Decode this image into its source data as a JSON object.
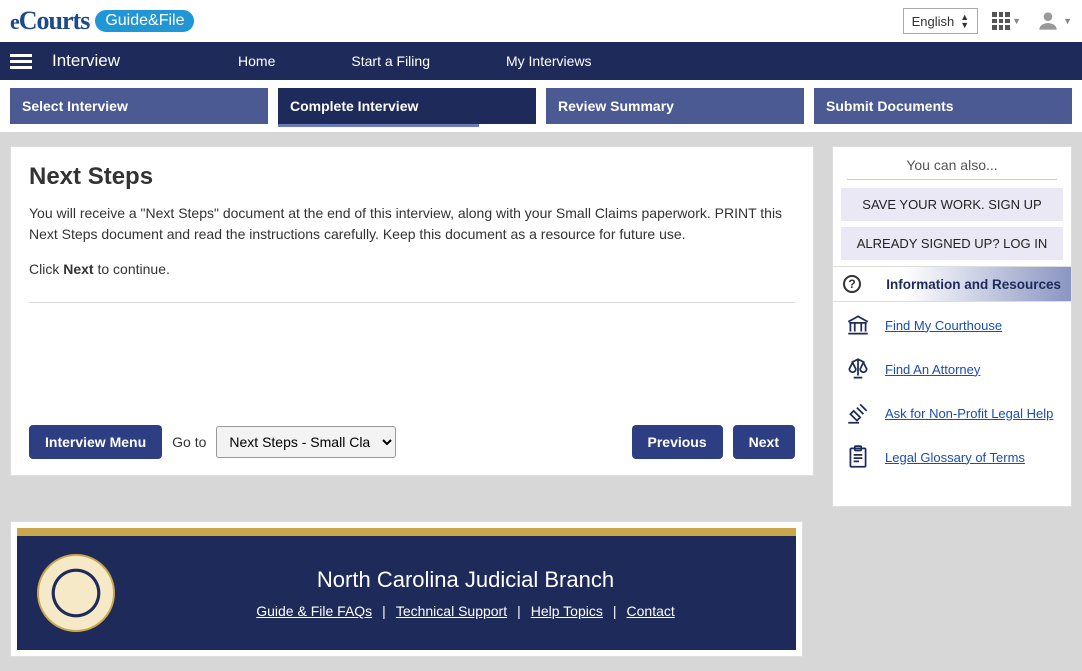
{
  "top": {
    "logo_main": "Courts",
    "logo_prefix": "e",
    "logo_badge": "Guide&File",
    "language": "English"
  },
  "nav": {
    "title": "Interview",
    "links": [
      "Home",
      "Start a Filing",
      "My Interviews"
    ]
  },
  "steps": [
    "Select Interview",
    "Complete Interview",
    "Review Summary",
    "Submit Documents"
  ],
  "active_step": 1,
  "main": {
    "heading": "Next Steps",
    "para1": "You will receive a \"Next Steps\" document at the end of this interview, along with your Small Claims paperwork. PRINT this Next Steps document and read the instructions carefully. Keep this document as a resource for future use.",
    "click_pre": "Click ",
    "click_bold": "Next",
    "click_post": " to continue.",
    "interview_menu": "Interview Menu",
    "goto_label": "Go to",
    "goto_value": "Next Steps - Small Claims",
    "previous": "Previous",
    "next": "Next"
  },
  "sidebar": {
    "youcan": "You can also...",
    "save": "SAVE YOUR WORK. SIGN UP",
    "login": "ALREADY SIGNED UP? LOG IN",
    "info_header": "Information and Resources",
    "resources": [
      {
        "label": "Find My Courthouse",
        "icon": "courthouse"
      },
      {
        "label": "Find An Attorney",
        "icon": "scales"
      },
      {
        "label": "Ask for Non-Profit Legal Help",
        "icon": "gavel"
      },
      {
        "label": "Legal Glossary of Terms",
        "icon": "clipboard"
      }
    ]
  },
  "footer": {
    "title": "North Carolina Judicial Branch",
    "links": [
      "Guide & File FAQs",
      "Technical Support",
      "Help Topics",
      "Contact"
    ]
  }
}
